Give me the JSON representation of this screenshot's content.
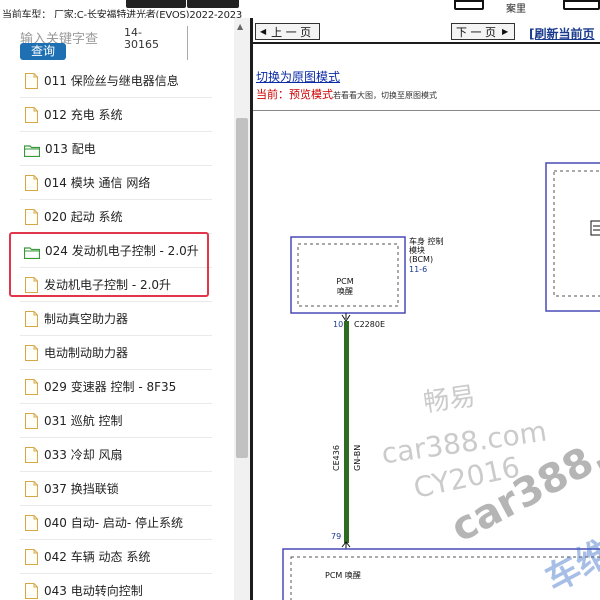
{
  "topbar": {
    "vehicle_info": "当前车型：   厂家:C-长安福特进光者(EVOS)2022-2023",
    "top_right_label": "案里"
  },
  "search": {
    "placeholder": "输入关键字查",
    "button_label": "查询",
    "code_line1": "14-",
    "code_line2": "30165"
  },
  "tree": [
    {
      "label": "011 保险丝与继电器信息",
      "kind": "doc"
    },
    {
      "label": "012 充电 系统",
      "kind": "doc"
    },
    {
      "label": "013 配电",
      "kind": "folder"
    },
    {
      "label": "014 模块 通信 网络",
      "kind": "doc"
    },
    {
      "label": "020 起动 系统",
      "kind": "doc"
    },
    {
      "label": "024 发动机电子控制 - 2.0升",
      "kind": "folder"
    },
    {
      "label": "发动机电子控制 - 2.0升",
      "kind": "doc"
    },
    {
      "label": "制动真空助力器",
      "kind": "doc"
    },
    {
      "label": "电动制动助力器",
      "kind": "doc"
    },
    {
      "label": "029 变速器 控制 - 8F35",
      "kind": "doc"
    },
    {
      "label": "031 巡航 控制",
      "kind": "doc"
    },
    {
      "label": "033 冷却 风扇",
      "kind": "doc"
    },
    {
      "label": "037 换挡联锁",
      "kind": "doc"
    },
    {
      "label": "040 自动- 启动- 停止系统",
      "kind": "doc"
    },
    {
      "label": "042 车辆 动态 系统",
      "kind": "doc"
    },
    {
      "label": "043 电动转向控制",
      "kind": "doc"
    }
  ],
  "nav": {
    "prev_label": "上 一 页",
    "next_label": "下 一 页",
    "refresh_label": "[刷新当前页"
  },
  "view": {
    "toggle_link": "切换为原图模式",
    "mode_prefix": "当前：",
    "mode_value": "预览模式",
    "mode_hint": "若看看大图，切换至原图模式"
  },
  "diagram": {
    "pcm_title": "PCM",
    "pcm_sub": "唤醒",
    "bcm_line1": "车身 控制",
    "bcm_line2": "模块",
    "bcm_line3": "(BCM)",
    "bcm_ref": "11-6",
    "pin_top": "10",
    "connector_top": "C2280E",
    "wire_id": "CE436",
    "wire_color": "GN-BN",
    "pin_bottom": "79",
    "bottom_box_label": "PCM 唤醒"
  },
  "watermarks": {
    "w1": "畅易",
    "w2": "car388.com",
    "w3": "CY2016",
    "w4": "car388.c",
    "w5": "车维"
  },
  "colors": {
    "search_button": "#1f6fb3",
    "highlight": "#e0354a",
    "wire": "#2f6b22",
    "box_border": "#4a4ab8",
    "link": "#0b2aa6",
    "mode_red": "#cc0000"
  }
}
